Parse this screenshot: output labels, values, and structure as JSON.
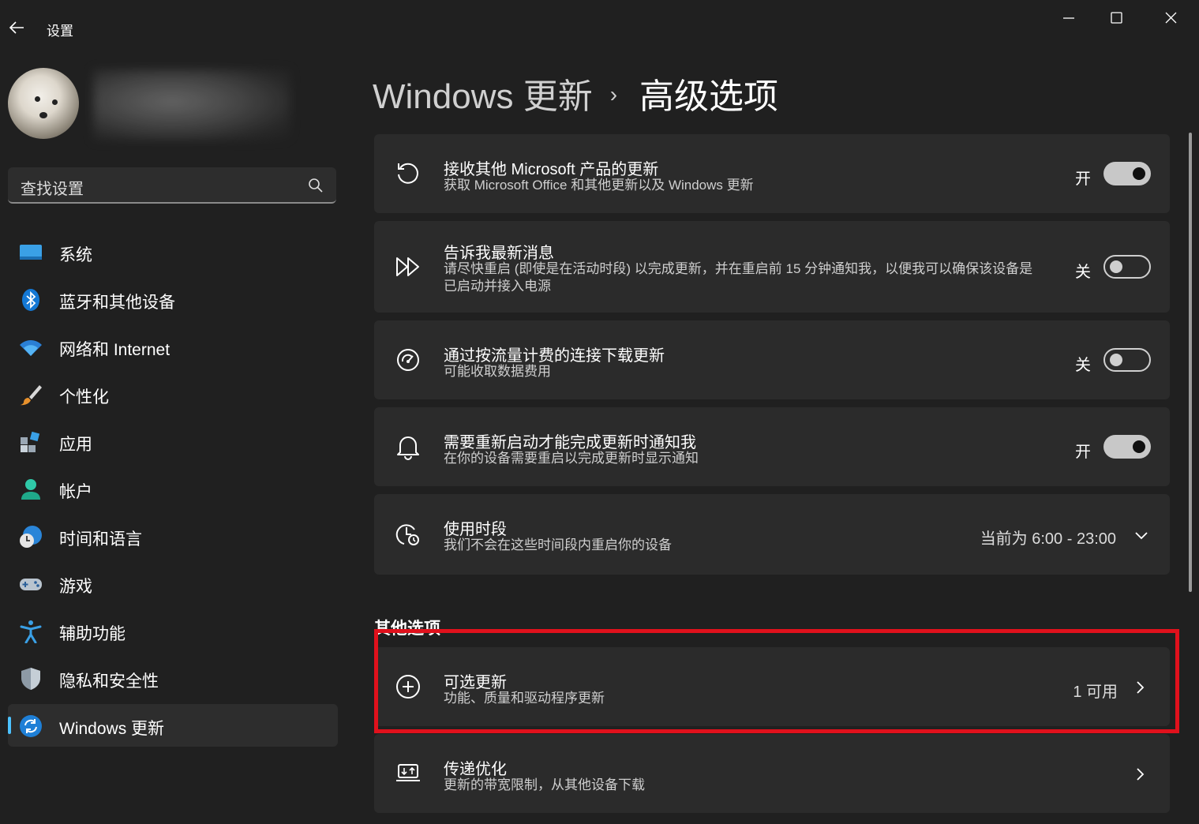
{
  "window": {
    "title": "设置"
  },
  "search": {
    "placeholder": "查找设置"
  },
  "nav": {
    "items": [
      {
        "label": "系统",
        "icon": "monitor-icon"
      },
      {
        "label": "蓝牙和其他设备",
        "icon": "bluetooth-icon"
      },
      {
        "label": "网络和 Internet",
        "icon": "wifi-icon"
      },
      {
        "label": "个性化",
        "icon": "paintbrush-icon"
      },
      {
        "label": "应用",
        "icon": "apps-icon"
      },
      {
        "label": "帐户",
        "icon": "person-icon"
      },
      {
        "label": "时间和语言",
        "icon": "globe-clock-icon"
      },
      {
        "label": "游戏",
        "icon": "gamepad-icon"
      },
      {
        "label": "辅助功能",
        "icon": "accessibility-icon"
      },
      {
        "label": "隐私和安全性",
        "icon": "shield-icon"
      },
      {
        "label": "Windows 更新",
        "icon": "sync-icon",
        "active": true
      }
    ]
  },
  "breadcrumb": {
    "parent": "Windows 更新",
    "separator": "›",
    "current": "高级选项"
  },
  "settings": [
    {
      "title": "接收其他 Microsoft 产品的更新",
      "subtitle": "获取 Microsoft Office 和其他更新以及 Windows 更新",
      "state": "开",
      "on": true,
      "icon": "refresh-icon"
    },
    {
      "title": "告诉我最新消息",
      "subtitle": "请尽快重启 (即使是在活动时段) 以完成更新，并在重启前 15 分钟通知我，以便我可以确保该设备是已启动并接入电源",
      "state": "关",
      "on": false,
      "icon": "fast-forward-icon"
    },
    {
      "title": "通过按流量计费的连接下载更新",
      "subtitle": "可能收取数据费用",
      "state": "关",
      "on": false,
      "icon": "speedometer-icon"
    },
    {
      "title": "需要重新启动才能完成更新时通知我",
      "subtitle": "在你的设备需要重启以完成更新时显示通知",
      "state": "开",
      "on": true,
      "icon": "bell-icon"
    }
  ],
  "active_hours": {
    "title": "使用时段",
    "subtitle": "我们不会在这些时间段内重启你的设备",
    "value": "当前为 6:00 - 23:00",
    "icon": "clock-icon"
  },
  "other_options": {
    "heading": "其他选项",
    "optional_updates": {
      "title": "可选更新",
      "subtitle": "功能、质量和驱动程序更新",
      "value": "1 可用",
      "icon": "plus-circle-icon"
    },
    "delivery_optimization": {
      "title": "传递优化",
      "subtitle": "更新的带宽限制，从其他设备下载",
      "icon": "delivery-icon"
    }
  },
  "colors": {
    "accent": "#4cc2ff",
    "highlight": "#e0111c",
    "background": "#202020",
    "card": "#2b2b2b"
  }
}
